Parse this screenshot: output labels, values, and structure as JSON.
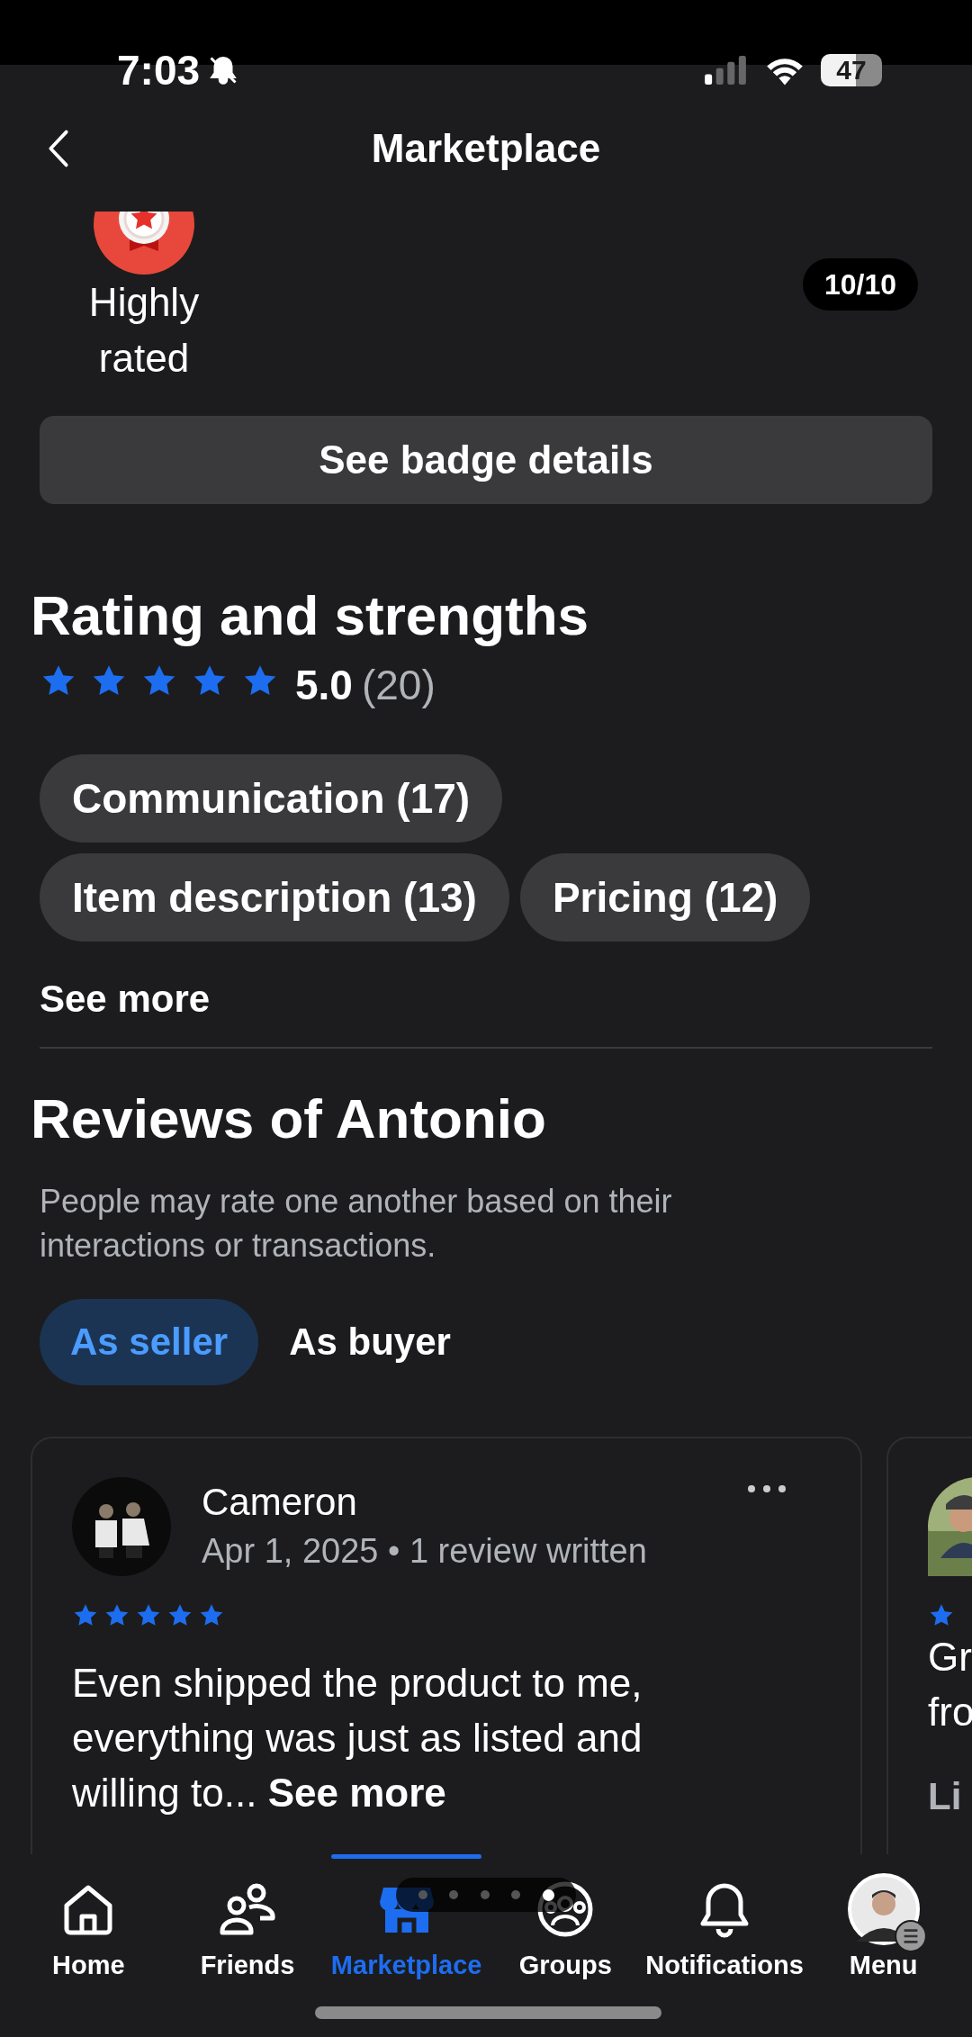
{
  "status_bar": {
    "time": "7:03",
    "battery": "47"
  },
  "header": {
    "title": "Marketplace"
  },
  "badge": {
    "label": "Highly rated",
    "counter": "10/10"
  },
  "badge_button": "See badge details",
  "rating": {
    "title": "Rating and strengths",
    "stars": 5,
    "score": "5.0",
    "count": "(20)"
  },
  "strengths": [
    {
      "label": "Communication (17)"
    },
    {
      "label": "Item description (13)"
    },
    {
      "label": "Pricing (12)"
    }
  ],
  "see_more": "See more",
  "reviews": {
    "title": "Reviews of Antonio",
    "description": "People may rate one another based on their interactions or transactions.",
    "tabs": [
      {
        "label": "As seller",
        "selected": true
      },
      {
        "label": "As buyer",
        "selected": false
      }
    ],
    "cards": [
      {
        "name": "Cameron",
        "meta": "Apr 1, 2025 • 1 review written",
        "stars": 5,
        "text": "Even shipped the product to me, everything was just as listed and willing to...",
        "more": "See more"
      },
      {
        "lines": [
          "Gr",
          "fro"
        ],
        "footer": "Li"
      }
    ]
  },
  "page_dots": [
    {
      "selected": false
    },
    {
      "selected": false
    },
    {
      "selected": false
    },
    {
      "selected": false
    },
    {
      "selected": true
    }
  ],
  "nav": [
    {
      "kind": "home",
      "label": "Home",
      "selected": false
    },
    {
      "kind": "friends",
      "label": "Friends",
      "selected": false
    },
    {
      "kind": "marketplace",
      "label": "Marketplace",
      "selected": true
    },
    {
      "kind": "groups",
      "label": "Groups",
      "selected": false
    },
    {
      "kind": "notifications",
      "label": "Notifications",
      "selected": false
    },
    {
      "kind": "menu",
      "label": "Menu",
      "selected": false
    }
  ]
}
